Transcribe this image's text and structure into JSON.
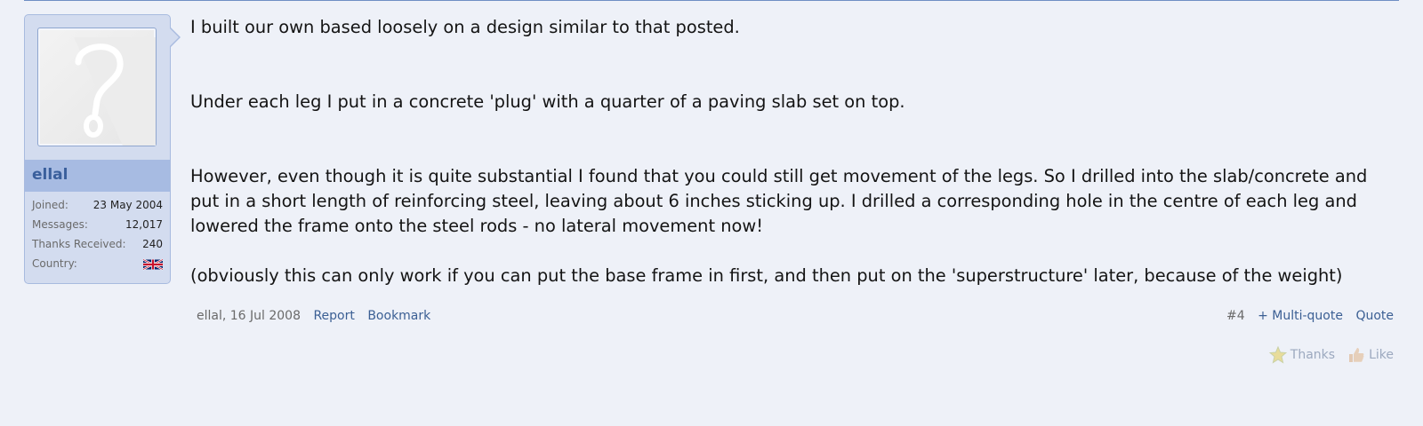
{
  "post": {
    "author": {
      "name": "ellal",
      "details": [
        {
          "label": "Joined:",
          "value": "23 May 2004"
        },
        {
          "label": "Messages:",
          "value": "12,017"
        },
        {
          "label": "Thanks Received:",
          "value": "240"
        },
        {
          "label": "Country:",
          "value": ""
        }
      ],
      "country_icon": "uk-flag-icon",
      "avatar_icon": "question-mark-avatar-icon"
    },
    "paragraphs": [
      "I built our own based loosely on a design similar to that posted.",
      "Under each leg I put in a concrete 'plug' with a quarter of a paving slab set on top.",
      "However, even though it is quite substantial I found that you could still get movement of the legs. So I drilled into the slab/concrete and put in a short length of reinforcing steel, leaving about 6 inches sticking up. I drilled a corresponding hole in the centre of each leg and lowered the frame onto the steel rods - no lateral movement now!",
      "(obviously this can only work if you can put the base frame in first, and then put on the 'superstructure' later, because of the weight)"
    ],
    "footer": {
      "byline": "ellal, 16 Jul 2008",
      "report": "Report",
      "bookmark": "Bookmark",
      "post_number": "#4",
      "multiquote": "+ Multi-quote",
      "quote": "Quote"
    },
    "reactions": {
      "thanks": "Thanks",
      "like": "Like"
    }
  },
  "colors": {
    "background": "#eef1f8",
    "panel": "#d3dcef",
    "username_bar": "#a7bbe2",
    "link": "#3b5f94"
  }
}
